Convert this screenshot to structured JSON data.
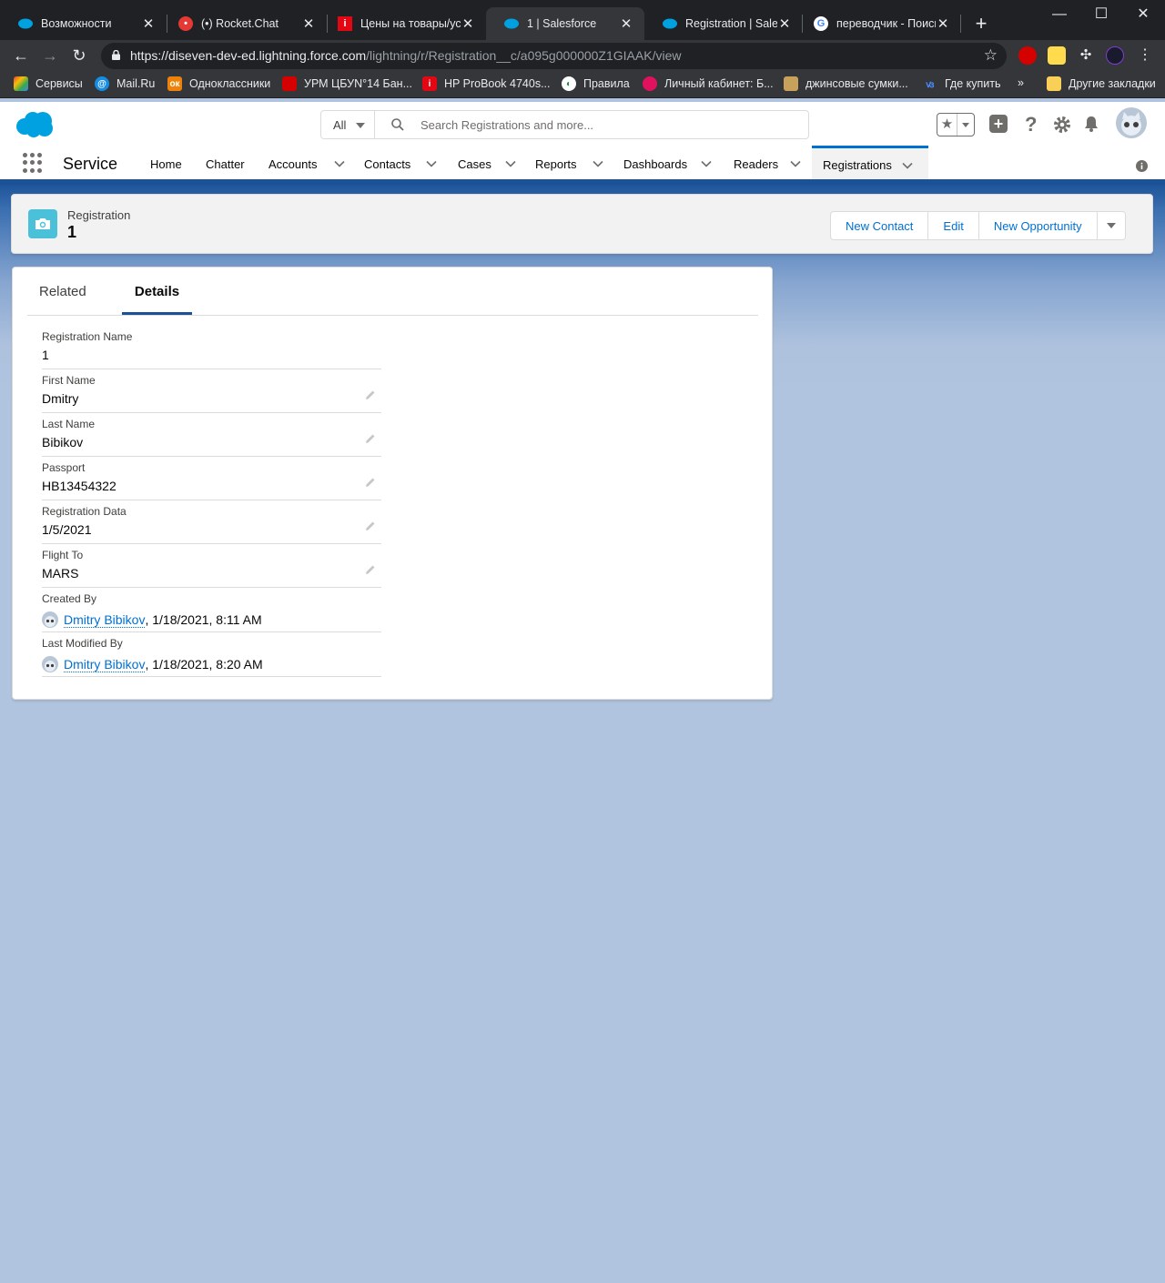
{
  "browser": {
    "tabs": [
      {
        "title": "Возможности"
      },
      {
        "title": "(•) Rocket.Chat"
      },
      {
        "title": "Цены на товары/услуги"
      },
      {
        "title": "1 | Salesforce"
      },
      {
        "title": "Registration | Salesforce"
      },
      {
        "title": "переводчик - Поиск"
      }
    ],
    "url_host": "https://diseven-dev-ed.lightning.force.com",
    "url_path": "/lightning/r/Registration__c/a095g000000Z1GIAAK/view",
    "bookmarks": [
      {
        "label": "Сервисы"
      },
      {
        "label": "Mail.Ru"
      },
      {
        "label": "Одноклассники"
      },
      {
        "label": "УРМ ЦБУN°14 Бан..."
      },
      {
        "label": "HP ProBook 4740s..."
      },
      {
        "label": "Правила"
      },
      {
        "label": "Личный кабинет: Б..."
      },
      {
        "label": "джинсовые сумки..."
      },
      {
        "label": "Где купить"
      },
      {
        "label": "»"
      },
      {
        "label": "Другие закладки"
      }
    ]
  },
  "search": {
    "scope": "All",
    "placeholder": "Search Registrations and more..."
  },
  "nav": {
    "app_name": "Service",
    "items": [
      {
        "label": "Home"
      },
      {
        "label": "Chatter"
      },
      {
        "label": "Accounts"
      },
      {
        "label": "Contacts"
      },
      {
        "label": "Cases"
      },
      {
        "label": "Reports"
      },
      {
        "label": "Dashboards"
      },
      {
        "label": "Readers"
      },
      {
        "label": "Registrations"
      }
    ]
  },
  "record": {
    "type": "Registration",
    "name": "1",
    "actions": {
      "new_contact": "New Contact",
      "edit": "Edit",
      "new_opportunity": "New Opportunity"
    }
  },
  "tabs": {
    "related": "Related",
    "details": "Details"
  },
  "fields": [
    {
      "label": "Registration Name",
      "value": "1"
    },
    {
      "label": "First Name",
      "value": "Dmitry"
    },
    {
      "label": "Last Name",
      "value": "Bibikov"
    },
    {
      "label": "Passport",
      "value": "HB13454322"
    },
    {
      "label": "Registration Data",
      "value": "1/5/2021"
    },
    {
      "label": "Flight To",
      "value": "MARS"
    }
  ],
  "created_by": {
    "label": "Created By",
    "user": "Dmitry Bibikov",
    "date": ", 1/18/2021, 8:11 AM"
  },
  "modified_by": {
    "label": "Last Modified By",
    "user": "Dmitry Bibikov",
    "date": ", 1/18/2021, 8:20 AM"
  },
  "colors": {
    "brand": "#1b5297",
    "link": "#0070d2",
    "record_icon": "#4bc0d9",
    "background": "#b0c4df"
  }
}
